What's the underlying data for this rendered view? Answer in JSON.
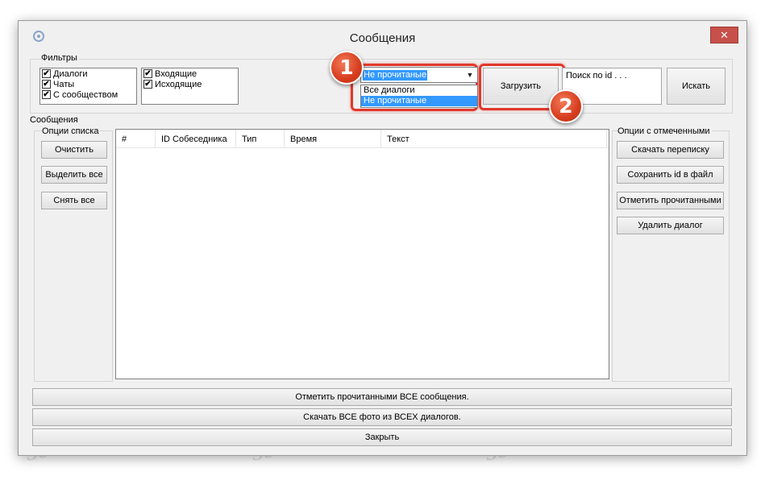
{
  "window": {
    "title": "Сообщения",
    "close_symbol": "✕"
  },
  "filters": {
    "label": "Фильтры",
    "left_checks": [
      {
        "label": "Диалоги",
        "checked": true
      },
      {
        "label": "Чаты",
        "checked": true
      },
      {
        "label": "С сообществом",
        "checked": true
      }
    ],
    "right_checks": [
      {
        "label": "Входящие",
        "checked": true
      },
      {
        "label": "Исходящие",
        "checked": true
      }
    ],
    "dropdown": {
      "selected": "Не прочитаные",
      "options": [
        "Все диалоги",
        "Не прочитаные"
      ]
    },
    "load_button": "Загрузить",
    "search_placeholder": "Поиск по id . . .",
    "search_button": "Искать",
    "check_mark": "✔"
  },
  "messages": {
    "label": "Сообщения",
    "list_options_label": "Опции списка",
    "list_buttons": [
      "Очистить",
      "Выделить все",
      "Снять все"
    ],
    "columns": [
      "#",
      "ID Собеседника",
      "Тип",
      "Время",
      "Текст"
    ],
    "marked_options_label": "Опции с отмеченными",
    "marked_buttons": [
      "Скачать переписку",
      "Сохранить id в файл",
      "Отметить прочитанными",
      "Удалить диалог"
    ]
  },
  "bottom_buttons": [
    "Отметить прочитанными ВСЕ сообщения.",
    "Скачать ВСЕ фото из ВСЕХ диалогов.",
    "Закрыть"
  ],
  "markers": [
    "1",
    "2"
  ],
  "watermark": "Soringpcrepair.Com",
  "colors": {
    "highlight_red": "#e0382c",
    "selection_blue": "#3399ff",
    "close_red": "#c7504a"
  }
}
